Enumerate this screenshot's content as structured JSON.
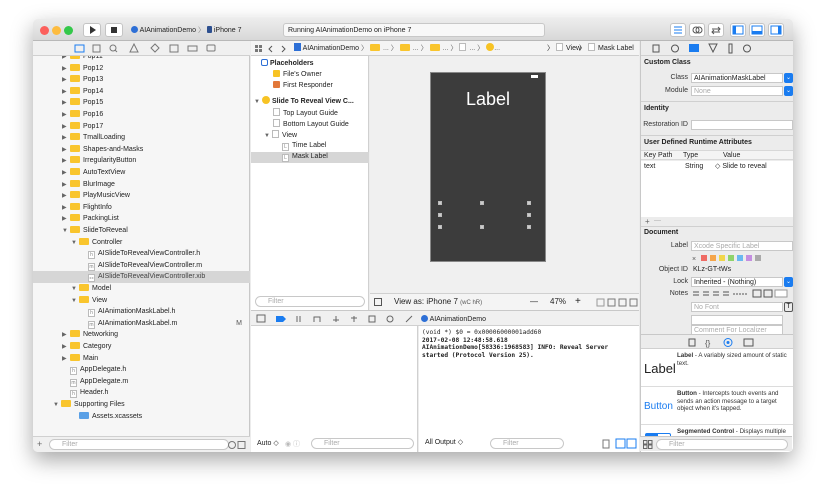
{
  "toolbar": {
    "scheme": "AIAnimationDemo",
    "device": "iPhone 7",
    "status": "Running AIAnimationDemo on iPhone 7"
  },
  "navigator": {
    "items": [
      {
        "label": "Pop11",
        "kind": "folder",
        "indent": 1,
        "expanded": false
      },
      {
        "label": "Pop12",
        "kind": "folder",
        "indent": 1,
        "expanded": false
      },
      {
        "label": "Pop13",
        "kind": "folder",
        "indent": 1,
        "expanded": false
      },
      {
        "label": "Pop14",
        "kind": "folder",
        "indent": 1,
        "expanded": false
      },
      {
        "label": "Pop15",
        "kind": "folder",
        "indent": 1,
        "expanded": false
      },
      {
        "label": "Pop16",
        "kind": "folder",
        "indent": 1,
        "expanded": false
      },
      {
        "label": "Pop17",
        "kind": "folder",
        "indent": 1,
        "expanded": false
      },
      {
        "label": "TmallLoading",
        "kind": "folder",
        "indent": 1,
        "expanded": false
      },
      {
        "label": "Shapes-and-Masks",
        "kind": "folder",
        "indent": 1,
        "expanded": false
      },
      {
        "label": "IrregularityButton",
        "kind": "folder",
        "indent": 1,
        "expanded": false
      },
      {
        "label": "AutoTextView",
        "kind": "folder",
        "indent": 1,
        "expanded": false
      },
      {
        "label": "BlurImage",
        "kind": "folder",
        "indent": 1,
        "expanded": false
      },
      {
        "label": "PlayMusicView",
        "kind": "folder",
        "indent": 1,
        "expanded": false
      },
      {
        "label": "FlightInfo",
        "kind": "folder",
        "indent": 1,
        "expanded": false
      },
      {
        "label": "PackingList",
        "kind": "folder",
        "indent": 1,
        "expanded": false
      },
      {
        "label": "SlideToReveal",
        "kind": "folder",
        "indent": 1,
        "expanded": true
      },
      {
        "label": "Controller",
        "kind": "folder",
        "indent": 2,
        "expanded": true
      },
      {
        "label": "AISlideToRevealViewController.h",
        "kind": "h",
        "indent": 3
      },
      {
        "label": "AISlideToRevealViewController.m",
        "kind": "m",
        "indent": 3
      },
      {
        "label": "AISlideToRevealViewController.xib",
        "kind": "xib",
        "indent": 3,
        "selected": true
      },
      {
        "label": "Model",
        "kind": "folder",
        "indent": 2,
        "expanded": true
      },
      {
        "label": "View",
        "kind": "folder",
        "indent": 2,
        "expanded": true
      },
      {
        "label": "AIAnimationMaskLabel.h",
        "kind": "h",
        "indent": 3
      },
      {
        "label": "AIAnimationMaskLabel.m",
        "kind": "m",
        "indent": 3,
        "badge": "M"
      },
      {
        "label": "Networking",
        "kind": "folder",
        "indent": 1,
        "expanded": false
      },
      {
        "label": "Category",
        "kind": "folder",
        "indent": 1,
        "expanded": false
      },
      {
        "label": "Main",
        "kind": "folder",
        "indent": 1,
        "expanded": false
      },
      {
        "label": "AppDelegate.h",
        "kind": "h",
        "indent": 1
      },
      {
        "label": "AppDelegate.m",
        "kind": "m",
        "indent": 1
      },
      {
        "label": "Header.h",
        "kind": "h",
        "indent": 1
      },
      {
        "label": "Supporting Files",
        "kind": "folder",
        "indent": 0,
        "expanded": true
      },
      {
        "label": "Assets.xcassets",
        "kind": "assets",
        "indent": 2
      }
    ],
    "filter_placeholder": "Filter"
  },
  "jumpbar": {
    "project": "AIAnimationDemo",
    "ellipsis": "...",
    "view": "View",
    "mask_label": "Mask Label"
  },
  "outline": {
    "placeholders_title": "Placeholders",
    "files_owner": "File's Owner",
    "first_responder": "First Responder",
    "scene": "Slide To Reveal View C...",
    "top_guide": "Top Layout Guide",
    "bottom_guide": "Bottom Layout Guide",
    "view": "View",
    "time_label": "Time Label",
    "mask_label": "Mask Label",
    "filter_placeholder": "Filter"
  },
  "canvas": {
    "device_label": "Label",
    "view_as": "View as: iPhone 7",
    "view_as_traits": "(wC hR)",
    "zoom": "47%",
    "minus": "—",
    "plus": "+"
  },
  "debug": {
    "process": "AIAnimationDemo",
    "auto_label": "Auto",
    "filter_placeholder": "Filter",
    "all_output": "All Output",
    "console_lines": [
      "(void *) $0 = 0x00006000001add60",
      "2017-02-08 12:48:58.618",
      "AIAnimationDemo[58336:1968583]  INFO: Reveal Server",
      "started (Protocol Version 25)."
    ]
  },
  "inspector": {
    "custom_class": {
      "title": "Custom Class",
      "class_label": "Class",
      "class_value": "AIAnimationMaskLabel",
      "module_label": "Module",
      "module_placeholder": "None"
    },
    "identity": {
      "title": "Identity",
      "restoration_label": "Restoration ID"
    },
    "runtime": {
      "title": "User Defined Runtime Attributes",
      "headers": [
        "Key Path",
        "Type",
        "Value"
      ],
      "row": [
        "text",
        "String",
        "Slide to reveal"
      ],
      "add": "+",
      "remove": "—"
    },
    "document": {
      "title": "Document",
      "label_label": "Label",
      "label_placeholder": "Xcode Specific Label",
      "object_id_label": "Object ID",
      "object_id": "KLz-GT-tWs",
      "lock_label": "Lock",
      "lock_value": "Inherited - (Nothing)",
      "notes_label": "Notes",
      "font_placeholder": "No Font",
      "comment_placeholder": "Comment For Localizer"
    },
    "library": [
      {
        "title": "Label",
        "desc": " - A variably sized amount of static text."
      },
      {
        "title": "Button",
        "desc": " - Intercepts touch events and sends an action message to a target object when it's tapped."
      },
      {
        "title": "Segmented Control",
        "desc": " - Displays multiple segments, each of which functions as a discrete button."
      }
    ],
    "segment_labels": [
      "1",
      "2"
    ],
    "filter_placeholder": "Filter"
  },
  "colors": {
    "accent": "#1a7cf0",
    "folder": "#f9c52d",
    "device_bg": "#3c3c3c",
    "selected_row": "#d6d6d6"
  }
}
